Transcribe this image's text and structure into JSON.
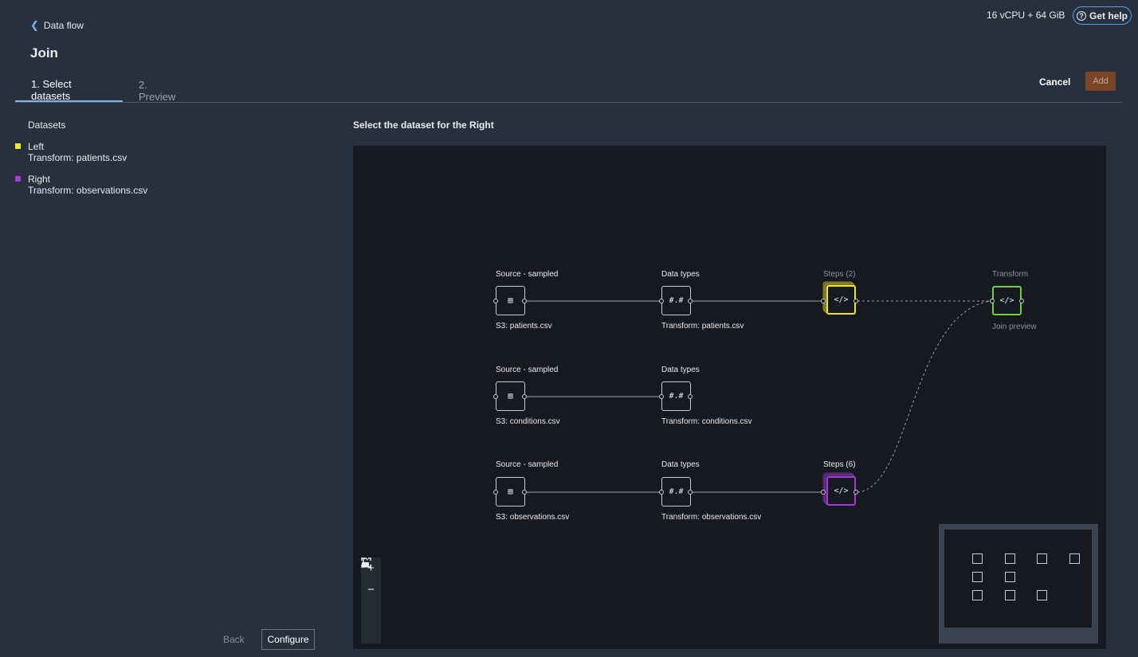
{
  "header": {
    "resources": "16 vCPU + 64 GiB",
    "help_label": "Get help",
    "back_link": "Data flow",
    "title": "Join"
  },
  "tabs": [
    {
      "label": "1. Select datasets",
      "active": true
    },
    {
      "label": "2. Preview",
      "active": false
    }
  ],
  "actions": {
    "cancel": "Cancel",
    "add": "Add"
  },
  "left_panel": {
    "heading": "Datasets",
    "datasets": [
      {
        "name": "Left",
        "source": "Transform: patients.csv",
        "color": "#f2e52c"
      },
      {
        "name": "Right",
        "source": "Transform: observations.csv",
        "color": "#a63bd4"
      }
    ],
    "back_button": "Back",
    "configure_button": "Configure"
  },
  "main": {
    "heading": "Select the dataset for the Right"
  },
  "flow": {
    "rows": [
      {
        "source_title": "Source - sampled",
        "source_name": "S3: patients.csv",
        "types_title": "Data types",
        "types_name": "Transform: patients.csv",
        "steps_title": "Steps (2)"
      },
      {
        "source_title": "Source - sampled",
        "source_name": "S3: conditions.csv",
        "types_title": "Data types",
        "types_name": "Transform: conditions.csv"
      },
      {
        "source_title": "Source - sampled",
        "source_name": "S3: observations.csv",
        "types_title": "Data types",
        "types_name": "Transform: observations.csv",
        "steps_title": "Steps (6)"
      }
    ],
    "transform_title": "Transform",
    "transform_name": "Join preview",
    "types_glyph": "#.#",
    "colors": {
      "left": "#f2e52c",
      "right": "#a63bd4",
      "join": "#6bd43a"
    }
  },
  "zoom": {
    "zoom_in": "+",
    "zoom_out": "−"
  }
}
